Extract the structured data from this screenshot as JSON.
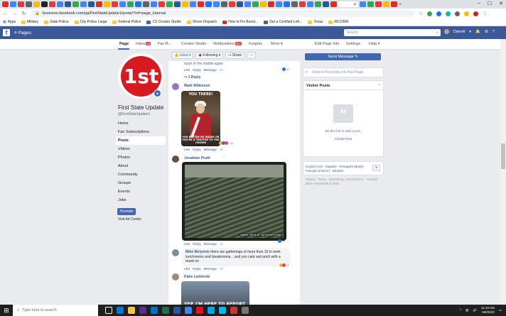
{
  "browser": {
    "address": "business.facebook.com/pg/FirstStateUpdate1/posts/?ref=page_internal",
    "bookmarks": [
      "Apps",
      "Military",
      "State Police",
      "City Police Large",
      "Federal Police",
      "CS Creator Studio",
      "Shore Dispatch",
      "How to Fix Boost...",
      "Get a Certified Left...",
      "Texas",
      "RICONN"
    ]
  },
  "fb": {
    "logo": "f",
    "section": "Pages",
    "search_placeholder": "Search",
    "user_name": "Darrell"
  },
  "page_tabs": [
    {
      "label": "Page"
    },
    {
      "label": "Inbox",
      "badge": "20"
    },
    {
      "label": "Fan B..."
    },
    {
      "label": "Creator Studio"
    },
    {
      "label": "Notifications",
      "badge": "20+"
    },
    {
      "label": "Insights"
    },
    {
      "label": "More ▾"
    },
    {
      "label": "Edit Page Info"
    },
    {
      "label": "Settings"
    },
    {
      "label": "Help ▾"
    }
  ],
  "actions": {
    "liked": "Liked ▾",
    "following": "Following ▾",
    "share": "Share",
    "more": "···",
    "send_message": "Send Message ✎"
  },
  "page": {
    "logo_text": "1st",
    "name": "First State Update",
    "handle": "@FirstStateUpdate1",
    "nav": [
      "Home",
      "Fan Subscriptions",
      "Posts",
      "Videos",
      "Photos",
      "About",
      "Community",
      "Groups",
      "Events",
      "Jobs"
    ],
    "promote": "Promote",
    "ad_center": "Visit Ad Center"
  },
  "feed": {
    "top_snippet": "stuck in the middle again",
    "actions": {
      "like": "Like",
      "reply": "Reply",
      "message": "Message",
      "time": "1h"
    },
    "top_react_count": "6",
    "reply_link": "↪ 1 Reply",
    "c1_name": "Mark Wilkinson",
    "c1_img_top": "YOU THERE!",
    "c1_img_bottom": "YOU BETTER BE INSIDE OR YOU'RE A TRAITOR TO THE CROWN",
    "c1_react_count": "31",
    "c2_name": "Jonathan Pruitt",
    "c2_more": "···",
    "c2_watermark": "MAKE GIFS AT GIFSOUP.COM",
    "c2_react_count": "1",
    "c3_name": "Mike Mclynnis",
    "c3_text": "there are gatherings of more than 10 in work lunchrooms and breakrooms... and you cant eat lunch with a mask on",
    "c3_react_count": "4",
    "c4_name": "Katie Ladzinski",
    "c4_img_text": "YEP, I'M HERE TO REPORT SOME"
  },
  "right": {
    "search_placeholder": "Search for posts on this Page",
    "visitor_title": "Visitor Posts",
    "visitor_empty": "Be the first to add a post.",
    "visitor_create": "Create Post",
    "lang_current": "English (US)",
    "langs": [
      "Español",
      "Português (Brasil)",
      "Français (France)",
      "Deutsch"
    ],
    "footer": "Privacy · Terms · Advertising · Ad Choices ▷ · Cookies · More ▾ Facebook © 2020"
  },
  "taskbar": {
    "search_placeholder": "Type here to search",
    "time": "11:10 AM",
    "date": "5/5/2020"
  }
}
